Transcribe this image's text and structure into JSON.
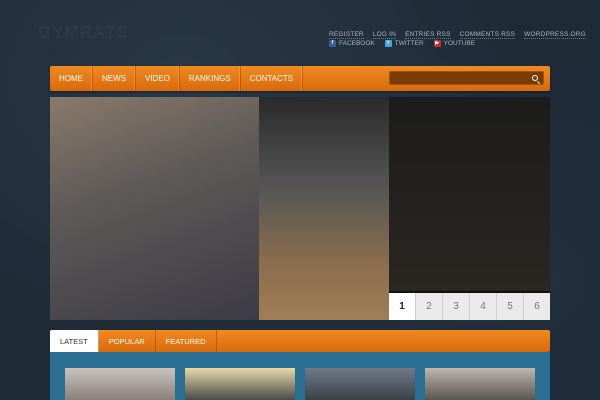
{
  "header": {
    "logo": "GYMRATS",
    "top_links": [
      "REGISTER",
      "LOG IN",
      "ENTRIES RSS",
      "COMMENTS RSS",
      "WORDPRESS.ORG"
    ],
    "social": [
      {
        "icon": "facebook-icon",
        "label": "FACEBOOK",
        "glyph": "f"
      },
      {
        "icon": "twitter-icon",
        "label": "TWITTER",
        "glyph": "t"
      },
      {
        "icon": "youtube-icon",
        "label": "YOUTUBE",
        "glyph": "▶"
      }
    ]
  },
  "nav": {
    "items": [
      "HOME",
      "NEWS",
      "VIDEO",
      "RANKINGS",
      "CONTACTS"
    ],
    "search_placeholder": ""
  },
  "slider": {
    "caption": "",
    "pages": [
      "1",
      "2",
      "3",
      "4",
      "5",
      "6"
    ],
    "active_page": "1"
  },
  "tabs": {
    "items": [
      "LATEST",
      "POPULAR",
      "FEATURED"
    ],
    "active": "LATEST"
  },
  "colors": {
    "accent": "#e87a16",
    "background": "#1e2a36",
    "panel": "#2a6e93"
  }
}
